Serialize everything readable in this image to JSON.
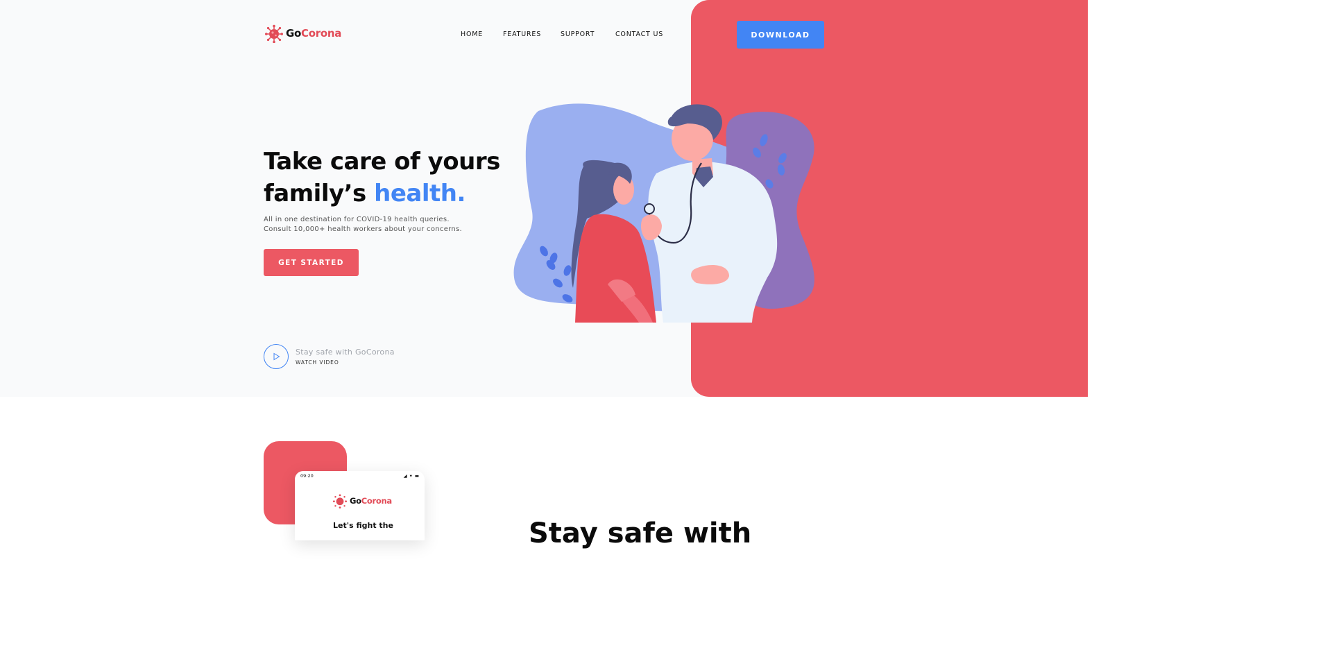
{
  "brand": {
    "name_part1": "Go",
    "name_part2": "Corona",
    "logo_icon": "virus-icon"
  },
  "nav": {
    "items": [
      {
        "label": "HOME"
      },
      {
        "label": "FEATURES"
      },
      {
        "label": "SUPPORT"
      },
      {
        "label": "CONTACT US"
      }
    ],
    "download_label": "DOWNLOAD"
  },
  "hero": {
    "headline_line1": "Take care of yours",
    "headline_line2_prefix": "family’s ",
    "headline_accent": "health.",
    "subtitle_line1": "All in one destination for COVID-19 health queries.",
    "subtitle_line2": "Consult 10,000+ health workers about your concerns.",
    "cta_label": "GET STARTED",
    "video_title": "Stay safe with GoCorona",
    "video_link": "WATCH VIDEO",
    "illustration": "doctor-patient-illustration"
  },
  "section2": {
    "phone_time": "09:20",
    "phone_heading": "Let's fight the",
    "title_partial": "Stay safe with"
  },
  "colors": {
    "brand_red": "#ec5863",
    "accent_blue": "#4285f4",
    "hero_bg": "#f9fafb"
  }
}
